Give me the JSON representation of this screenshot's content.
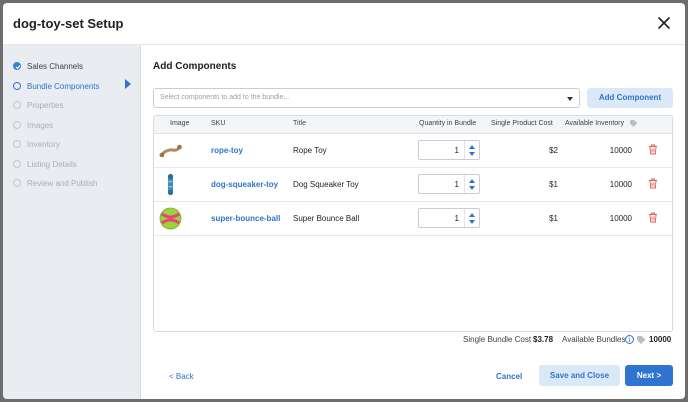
{
  "modal": {
    "title": "dog-toy-set Setup"
  },
  "sidebar": {
    "steps": [
      {
        "label": "Sales Channels",
        "state": "done"
      },
      {
        "label": "Bundle Components",
        "state": "active"
      },
      {
        "label": "Properties",
        "state": "pending"
      },
      {
        "label": "Images",
        "state": "pending"
      },
      {
        "label": "Inventory",
        "state": "pending"
      },
      {
        "label": "Listing Details",
        "state": "pending"
      },
      {
        "label": "Review and Publish",
        "state": "pending"
      }
    ]
  },
  "main": {
    "section_title": "Add Components",
    "select_placeholder": "Select components to add to the bundle...",
    "add_button": "Add Component",
    "table": {
      "columns": [
        "Image",
        "SKU",
        "Title",
        "Quantity in Bundle",
        "Single Product Cost",
        "Available Inventory"
      ],
      "rows": [
        {
          "image": "rope-toy-image",
          "sku": "rope-toy",
          "title": "Rope Toy",
          "qty": "1",
          "cost": "$2",
          "inventory": "10000"
        },
        {
          "image": "squeaker-toy-image",
          "sku": "dog-squeaker-toy",
          "title": "Dog Squeaker Toy",
          "qty": "1",
          "cost": "$1",
          "inventory": "10000"
        },
        {
          "image": "bounce-ball-image",
          "sku": "super-bounce-ball",
          "title": "Super Bounce Ball",
          "qty": "1",
          "cost": "$1",
          "inventory": "10000"
        }
      ]
    },
    "summary": {
      "cost_label": "Single Bundle Cost",
      "cost_value": "$3.78",
      "bundles_label": "Available Bundles",
      "bundles_value": "10000"
    },
    "footer": {
      "back": "< Back",
      "cancel": "Cancel",
      "save": "Save and Close",
      "next": "Next >"
    }
  },
  "colors": {
    "accent": "#2f74d0",
    "accent_light": "#dbe8f7",
    "sidebar_bg": "#e9ecf1",
    "delete": "#e05a5a"
  }
}
